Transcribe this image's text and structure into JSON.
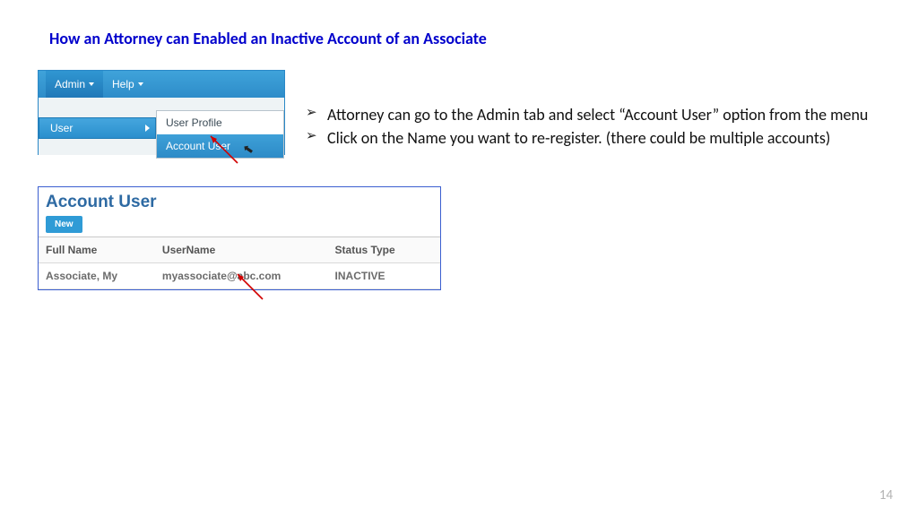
{
  "title": "How an Attorney can  Enabled an Inactive Account of an Associate",
  "menu": {
    "tabs": {
      "admin": "Admin",
      "help": "Help"
    },
    "user_label": "User",
    "submenu": {
      "profile": "User Profile",
      "account_user": "Account User"
    }
  },
  "bullets": [
    "Attorney can go to the Admin tab and select “Account User” option from the menu",
    "Click on the Name you want to re-register. (there could be multiple accounts)"
  ],
  "panel": {
    "title": "Account User",
    "new_button": "New",
    "columns": {
      "full_name": "Full Name",
      "username": "UserName",
      "status": "Status Type"
    },
    "rows": [
      {
        "full_name": "Associate, My",
        "username": "myassociate@abc.com",
        "status": "INACTIVE"
      }
    ]
  },
  "page_number": "14"
}
